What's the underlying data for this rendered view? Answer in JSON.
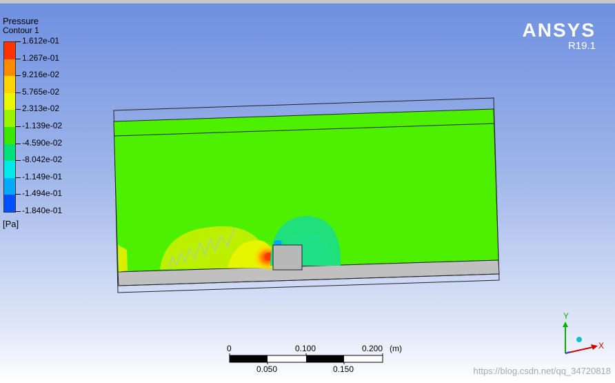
{
  "legend": {
    "title": "Pressure",
    "subtitle": "Contour 1",
    "unit": "[Pa]",
    "ticks": [
      "1.612e-01",
      "1.267e-01",
      "9.216e-02",
      "5.765e-02",
      "2.313e-02",
      "-1.139e-02",
      "-4.590e-02",
      "-8.042e-02",
      "-1.149e-01",
      "-1.494e-01",
      "-1.840e-01"
    ],
    "colors": [
      "#ff3300",
      "#ff8a00",
      "#ffd400",
      "#e9f700",
      "#9af400",
      "#3ae800",
      "#00e07a",
      "#00e8e8",
      "#00aaff",
      "#0050ff"
    ]
  },
  "brand": {
    "name": "ANSYS",
    "version": "R19.1"
  },
  "scale": {
    "top_labels": [
      "0",
      "0.100",
      "0.200"
    ],
    "unit": "(m)",
    "bottom_labels": [
      "0.050",
      "0.150"
    ]
  },
  "axes": {
    "x": "X",
    "y": "Y"
  },
  "watermark": "https://blog.csdn.net/qq_34720818",
  "colors": {
    "field": "#4cf000",
    "wall": "#c0c0c0"
  }
}
